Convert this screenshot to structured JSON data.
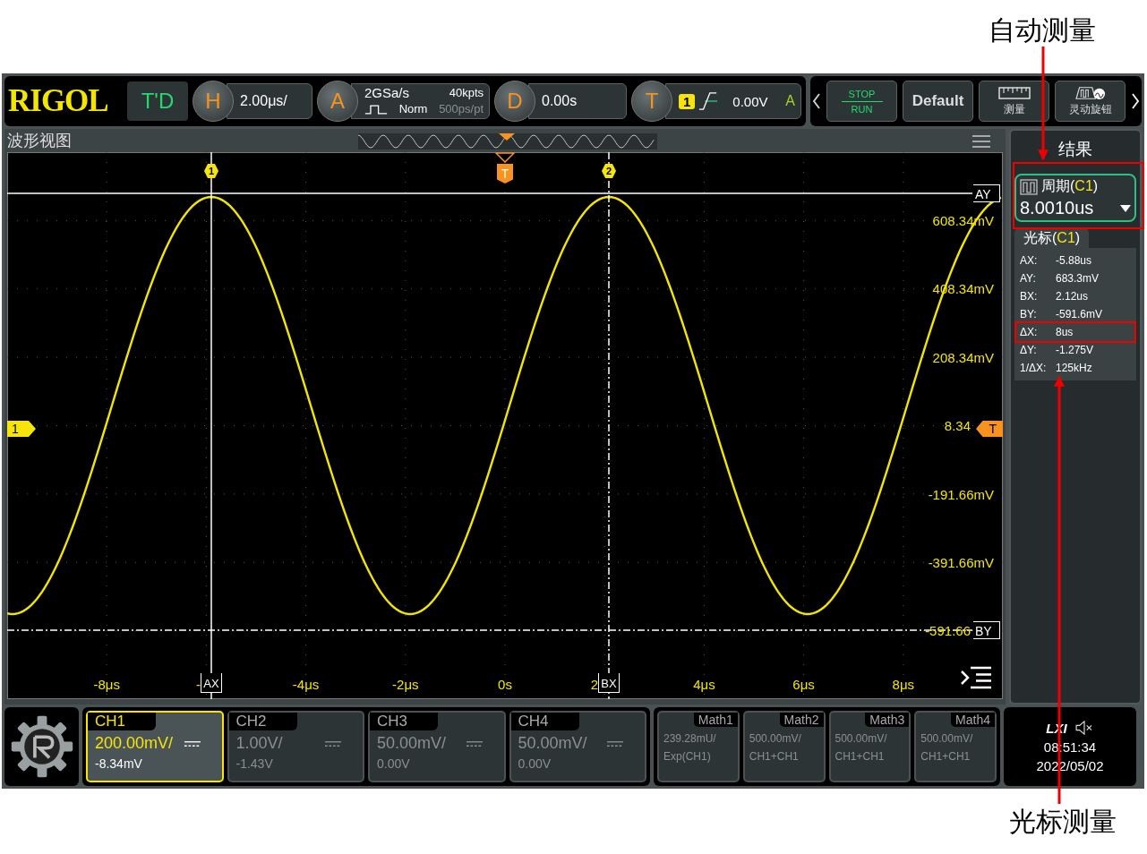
{
  "annotations": [
    {
      "text": "自动测量"
    },
    {
      "text": "光标测量"
    }
  ],
  "top_bar": {
    "logo": "RIGOL",
    "mode": "T'D",
    "horizontal": {
      "key": "H",
      "value": "2.00μs/"
    },
    "acquire": {
      "key": "A",
      "sample_rate": "2GSa/s",
      "memory": "40kpts",
      "mode": "Norm",
      "resolution": "500ps/pt"
    },
    "delay": {
      "key": "D",
      "value": "0.00s"
    },
    "trigger": {
      "key": "T",
      "source": "1",
      "level": "0.00V",
      "sweep": "A"
    }
  },
  "toolbar": [
    {
      "kind": "runstop",
      "top": "STOP",
      "bottom": "RUN"
    },
    {
      "kind": "text",
      "label": "Default"
    },
    {
      "kind": "ruler",
      "label": "测量"
    },
    {
      "kind": "knob",
      "label": "灵动旋钮"
    }
  ],
  "waveform_view": {
    "title": "波形视图",
    "x_labels": [
      "-8μs",
      "-",
      "-4μs",
      "-2μs",
      "0s",
      "2",
      "4μs",
      "6μs",
      "8μs"
    ],
    "y_labels": [
      "608.34mV",
      "408.34mV",
      "208.34mV",
      "8.34",
      "-191.66mV",
      "-391.66mV",
      "-591.66"
    ],
    "markers": [
      {
        "kind": "cursor-top",
        "label": "1"
      },
      {
        "kind": "trigger-pos",
        "label": "T"
      },
      {
        "kind": "cursor-top",
        "label": "2"
      },
      {
        "kind": "channel",
        "label": "1"
      },
      {
        "kind": "cursor-right",
        "label": "AY"
      },
      {
        "kind": "cursor-right",
        "label": "BY"
      },
      {
        "kind": "trigger-level",
        "label": "T"
      },
      {
        "kind": "cursor-bottom",
        "label": "AX"
      },
      {
        "kind": "cursor-bottom",
        "label": "BX"
      }
    ]
  },
  "results": {
    "title": "结果",
    "measurement": {
      "name": "周期(**C1**)",
      "value": "8.0010us"
    },
    "cursor": {
      "title": "光标(**C1**)",
      "rows": [
        {
          "label": "AX:",
          "value": "-5.88us",
          "highlighted": false
        },
        {
          "label": "AY:",
          "value": "683.3mV",
          "highlighted": false
        },
        {
          "label": "BX:",
          "value": "2.12us",
          "highlighted": false
        },
        {
          "label": "BY:",
          "value": "-591.6mV",
          "highlighted": false
        },
        {
          "label": "ΔX:",
          "value": "8us",
          "highlighted": true
        },
        {
          "label": "ΔY:",
          "value": "-1.275V",
          "highlighted": false
        },
        {
          "label": "1/ΔX:",
          "value": "125kHz",
          "highlighted": false
        }
      ]
    }
  },
  "channels": [
    {
      "name": "CH1",
      "scale": "200.00mV/",
      "offset": "-8.34mV",
      "active": true
    },
    {
      "name": "CH2",
      "scale": "1.00V/",
      "offset": "-1.43V",
      "active": false
    },
    {
      "name": "CH3",
      "scale": "50.00mV/",
      "offset": "0.00V",
      "active": false
    },
    {
      "name": "CH4",
      "scale": "50.00mV/",
      "offset": "0.00V",
      "active": false
    }
  ],
  "math": [
    {
      "name": "Math1",
      "scale": "239.28mU/",
      "source": "Exp(CH1)"
    },
    {
      "name": "Math2",
      "scale": "500.00mV/",
      "source": "CH1+CH1"
    },
    {
      "name": "Math3",
      "scale": "500.00mV/",
      "source": "CH1+CH1"
    },
    {
      "name": "Math4",
      "scale": "500.00mV/",
      "source": "CH1+CH1"
    }
  ],
  "status": {
    "lxi": "LXI",
    "time": "08:51:34",
    "date": "2022/05/02"
  }
}
